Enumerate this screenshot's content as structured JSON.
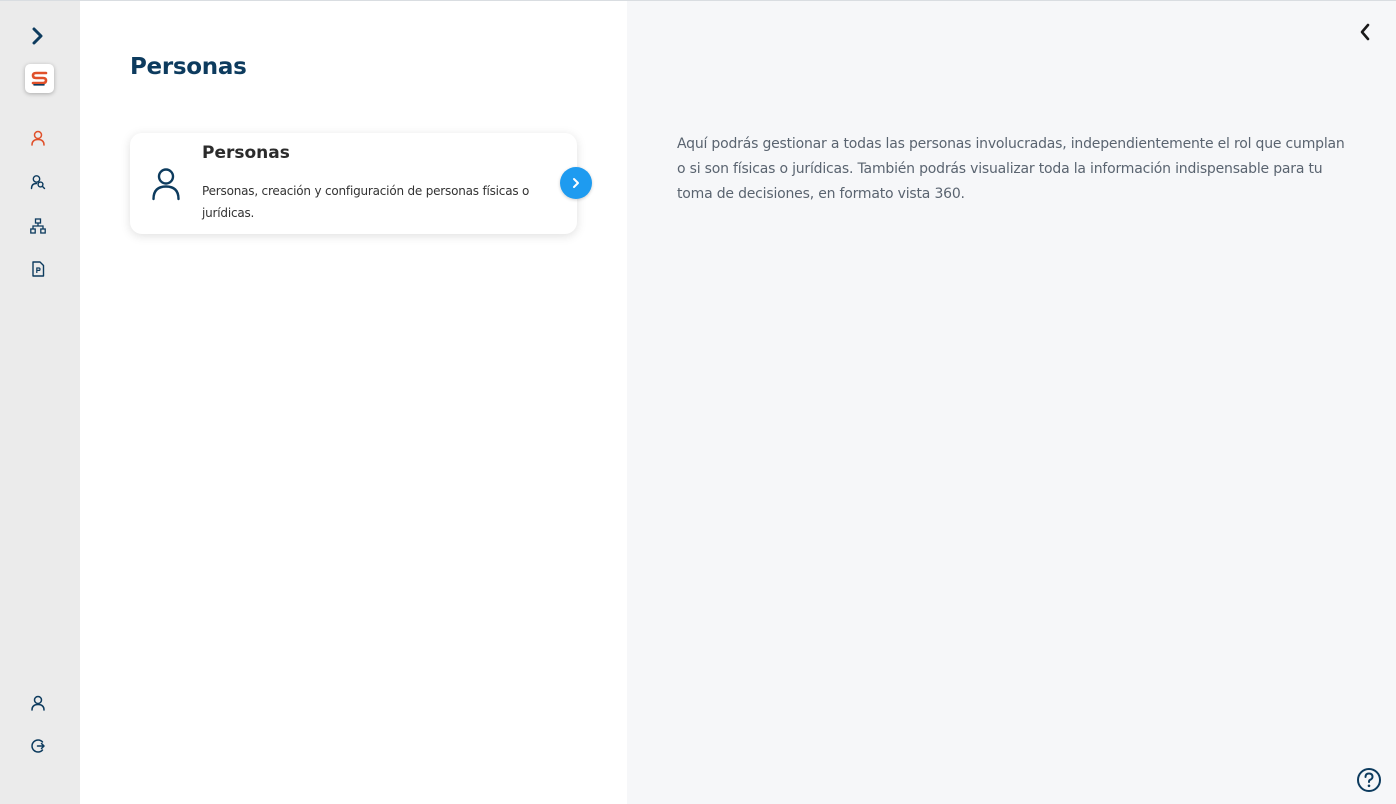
{
  "sidebar": {
    "expand_icon": "chevron-right-icon",
    "logo_icon": "app-logo-icon",
    "items": [
      {
        "icon": "person-icon",
        "active": true
      },
      {
        "icon": "people-search-icon",
        "active": false
      },
      {
        "icon": "hierarchy-icon",
        "active": false
      },
      {
        "icon": "document-icon",
        "active": false
      }
    ],
    "bottom_items": [
      {
        "icon": "user-profile-icon"
      },
      {
        "icon": "logout-icon"
      }
    ]
  },
  "main": {
    "title": "Personas",
    "card": {
      "title": "Personas",
      "description": "Personas, creación y configuración de personas físicas o jurídicas.",
      "icon": "person-icon"
    }
  },
  "info_panel": {
    "text": "Aquí podrás gestionar a todas las personas involucradas, independientemente el rol que cumplan o si son físicas o jurídicas. También podrás visualizar toda la información indispensable para tu toma de decisiones, en formato vista 360.",
    "collapse_icon": "chevron-left-icon",
    "help_icon": "help-icon"
  },
  "colors": {
    "primary_dark": "#0d3b5e",
    "accent_blue": "#1e9bf0",
    "active_orange": "#e0502a",
    "sidebar_bg": "#ebebeb",
    "info_bg": "#f6f7f9"
  }
}
